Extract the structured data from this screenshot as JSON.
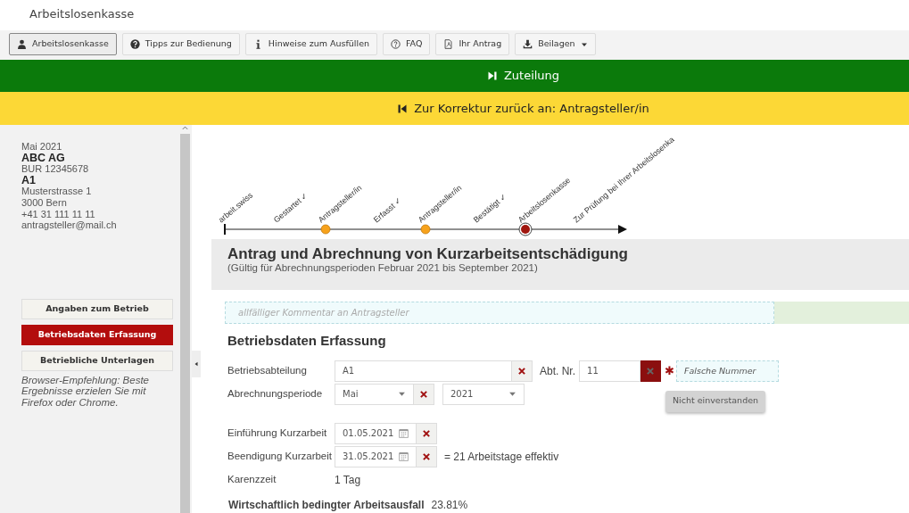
{
  "page_title": "Arbeitslosenkasse",
  "toolbar": [
    {
      "label": "Arbeitslosenkasse",
      "selected": true,
      "dropdown": false
    },
    {
      "label": "Tipps zur Bedienung",
      "selected": false,
      "dropdown": false
    },
    {
      "label": "Hinweise zum Ausfüllen",
      "selected": false,
      "dropdown": false
    },
    {
      "label": "FAQ",
      "selected": false,
      "dropdown": false
    },
    {
      "label": "Ihr Antrag",
      "selected": false,
      "dropdown": false
    },
    {
      "label": "Beilagen",
      "selected": false,
      "dropdown": true
    }
  ],
  "forward_bar": {
    "label": "Zuteilung"
  },
  "back_bar": {
    "label": "Zur Korrektur zurück an: Antragsteller/in"
  },
  "sidebar": {
    "info": [
      {
        "text": "Mai 2021",
        "bold": false
      },
      {
        "text": "ABC AG",
        "bold": true
      },
      {
        "text": "BUR 12345678",
        "bold": false
      },
      {
        "text": "A1",
        "bold": true
      },
      {
        "text": "Musterstrasse 1",
        "bold": false
      },
      {
        "text": "3000 Bern",
        "bold": false
      },
      {
        "text": "+41 31 111 11 11",
        "bold": false
      },
      {
        "text": "antragsteller@mail.ch",
        "bold": false
      }
    ],
    "nav": [
      {
        "label": "Angaben zum Betrieb",
        "selected": false
      },
      {
        "label": "Betriebsdaten Erfassung",
        "selected": true
      },
      {
        "label": "Betriebliche Unterlagen",
        "selected": false
      }
    ],
    "note": "Browser-Empfehlung: Beste Ergebnisse erzielen Sie mit Firefox oder Chrome."
  },
  "timeline": [
    {
      "label": "arbeit.swiss",
      "kind": "start"
    },
    {
      "label": "Gestartet ✓",
      "kind": "plain"
    },
    {
      "label": "Antragsteller/in",
      "kind": "done"
    },
    {
      "label": "Erfasst ✓",
      "kind": "plain"
    },
    {
      "label": "Antragsteller/in",
      "kind": "done"
    },
    {
      "label": "Bestätigt ✓",
      "kind": "plain"
    },
    {
      "label": "Arbeitslosenkasse",
      "kind": "current"
    },
    {
      "label": "Zur Prüfung bei Ihrer Arbeitslosenka",
      "kind": "plain"
    }
  ],
  "heading": {
    "title": "Antrag und Abrechnung von Kurzarbeitsentschädigung",
    "subtitle": "(Gültig für Abrechnungsperioden Februar 2021 bis September 2021)"
  },
  "form": {
    "comment_placeholder": "allfälliger Kommentar an Antragsteller",
    "section_title": "Betriebsdaten Erfassung",
    "department": {
      "label": "Betriebsabteilung",
      "value": "A1",
      "rejected": false
    },
    "dept_number": {
      "label": "Abt. Nr.",
      "value": "11",
      "rejected": true,
      "required_mark": "✱",
      "comment": "Falsche Nummer",
      "action": "Nicht einverstanden"
    },
    "period": {
      "label": "Abrechnungsperiode",
      "month": "Mai",
      "month_rejected": false,
      "year": "2021"
    },
    "dates": [
      {
        "label": "Einführung Kurzarbeit",
        "value": "01.05.2021",
        "rejected": false
      },
      {
        "label": "Beendigung Kurzarbeit",
        "value": "31.05.2021",
        "rejected": false,
        "suffix": "= 21 Arbeitstage effektiv"
      }
    ],
    "waiting": {
      "label": "Karenzzeit",
      "value": "1 Tag"
    },
    "loss": {
      "label": "Wirtschaftlich bedingter Arbeitsausfall",
      "value": "23.81%"
    }
  }
}
